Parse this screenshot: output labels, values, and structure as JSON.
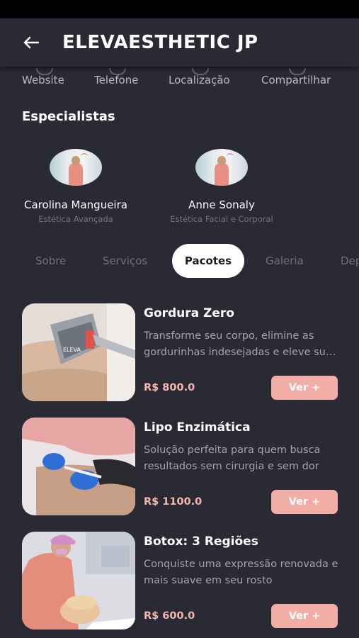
{
  "header": {
    "title": "ELEVAESTHETIC JP"
  },
  "actions": [
    {
      "label": "Website",
      "icon": "globe-icon"
    },
    {
      "label": "Telefone",
      "icon": "phone-icon"
    },
    {
      "label": "Localização",
      "icon": "map-pin-icon"
    },
    {
      "label": "Compartilhar",
      "icon": "share-icon"
    }
  ],
  "specialists_title": "Especialistas",
  "specialists": [
    {
      "name": "Carolina Mangueira",
      "role": "Estética Avançada"
    },
    {
      "name": "Anne Sonaly",
      "role": "Estética Facial e Corporal"
    }
  ],
  "tabs": [
    {
      "label": "Sobre",
      "active": false
    },
    {
      "label": "Serviços",
      "active": false
    },
    {
      "label": "Pacotes",
      "active": true
    },
    {
      "label": "Galeria",
      "active": false
    },
    {
      "label": "Depoimentos",
      "active": false
    }
  ],
  "packages": [
    {
      "title": "Gordura Zero",
      "description": "Transforme seu corpo, elimine as gordurinhas indesejadas e eleve sua autoestima",
      "price": "R$ 800.0",
      "button": "Ver +"
    },
    {
      "title": "Lipo Enzimática",
      "description": "Solução perfeita para quem busca resultados sem cirurgia e sem dor",
      "price": "R$ 1100.0",
      "button": "Ver +"
    },
    {
      "title": "Botox: 3 Regiões",
      "description": "Conquiste uma expressão renovada e mais suave em seu rosto",
      "price": "R$ 600.0",
      "button": "Ver +"
    }
  ],
  "colors": {
    "background": "#292a34",
    "accent": "#f2aea6",
    "price": "#f4b6ad",
    "muted_text": "#a3a3ad"
  }
}
